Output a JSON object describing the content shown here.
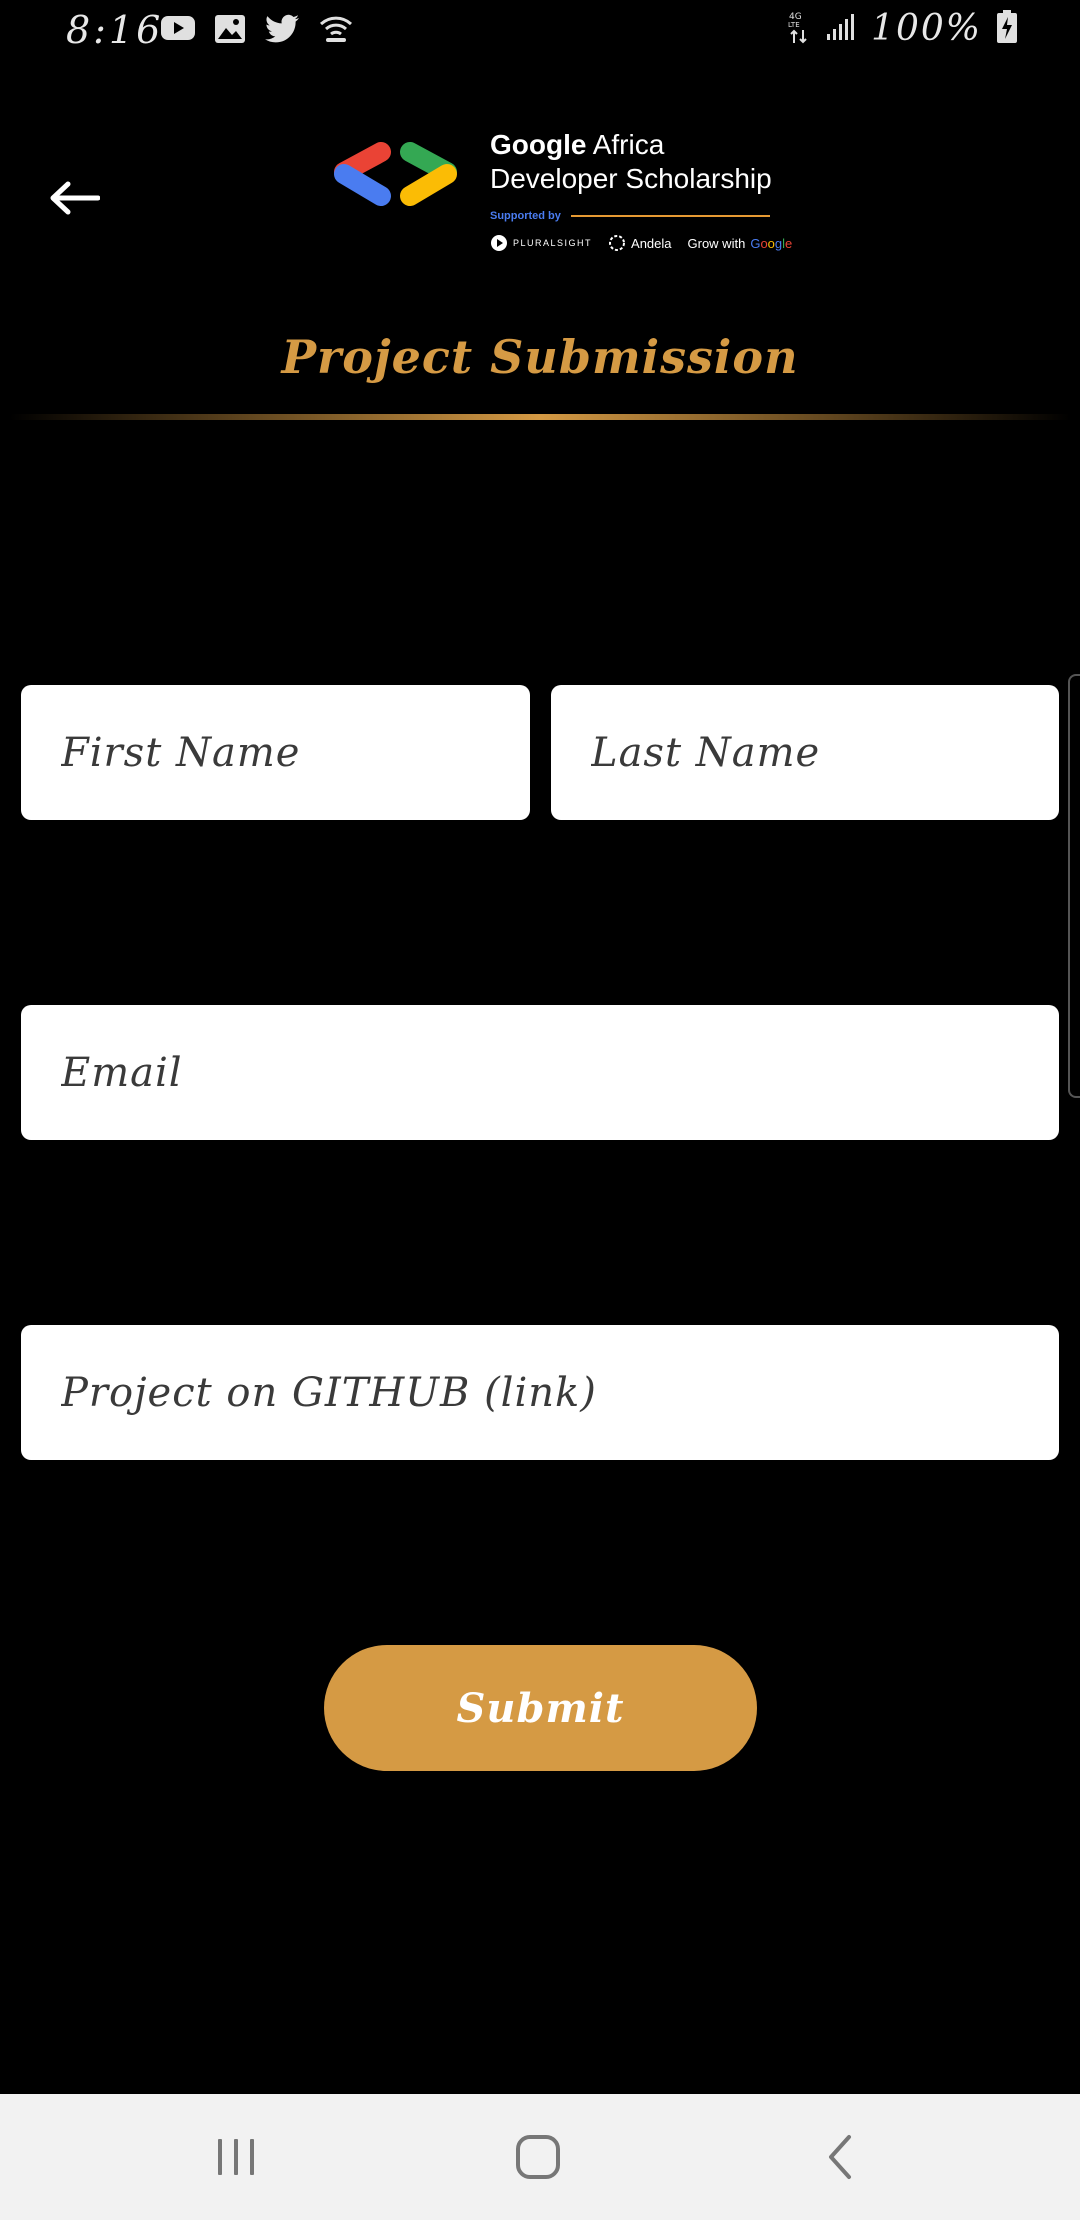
{
  "status_bar": {
    "time": "8:16",
    "battery_text": "100%",
    "network_label": "4G LTE",
    "left_icons": [
      "youtube-icon",
      "gallery-icon",
      "twitter-icon",
      "wifi-calling-icon"
    ],
    "right_icons": [
      "data-arrows-icon",
      "signal-bars-icon",
      "battery-charging-icon"
    ]
  },
  "header": {
    "back_icon": "arrow-left-icon",
    "logo": {
      "line1_bold": "Google",
      "line1_rest": " Africa",
      "line2": "Developer Scholarship",
      "supported_by": "Supported by",
      "sponsors": [
        "PLURALSIGHT",
        "Andela",
        "Grow with",
        "Google"
      ]
    },
    "title": "Project Submission"
  },
  "form": {
    "first_name_placeholder": "First Name",
    "last_name_placeholder": "Last Name",
    "email_placeholder": "Email",
    "github_placeholder": "Project on GITHUB (link)",
    "submit_label": "Submit"
  },
  "colors": {
    "accent": "#d59a44",
    "background": "#000000",
    "field_background": "#ffffff",
    "nav_background": "#f2f2f2",
    "logo_blue": "#4a7cf0",
    "logo_red": "#ea4335",
    "logo_green": "#34a853",
    "logo_yellow": "#fbbc05"
  },
  "nav_bar": {
    "icons": [
      "recents-icon",
      "home-icon",
      "back-chevron-icon"
    ]
  }
}
